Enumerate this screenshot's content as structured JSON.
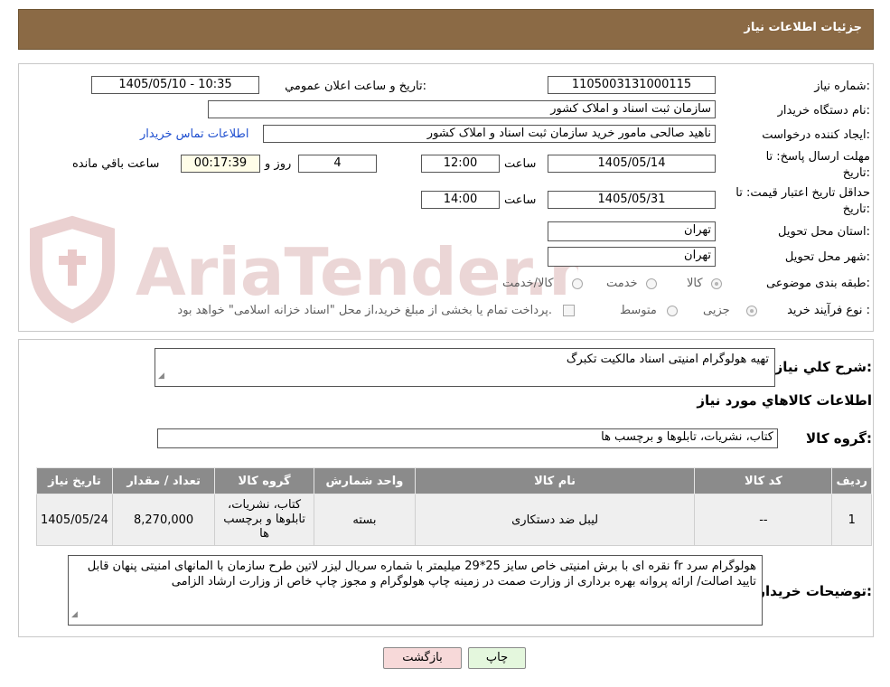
{
  "header": {
    "title": "جزئیات اطلاعات نیاز"
  },
  "watermark": {
    "text": "AriaTender.neT"
  },
  "form": {
    "need_number": {
      "label": "شماره نیاز:",
      "value": "1105003131000115"
    },
    "announce_datetime": {
      "label": "تاريخ و ساعت اعلان عمومي:",
      "value": "1405/05/10 - 10:35"
    },
    "buyer_org": {
      "label": "نام دستگاه خریدار:",
      "value": "سازمان ثبت اسناد و املاک کشور"
    },
    "requester": {
      "label": "ایجاد کننده درخواست:",
      "value": "ناهید صالحی مامور خرید سازمان ثبت اسناد و املاک کشور",
      "contact_link": "اطلاعات تماس خریدار"
    },
    "response_deadline": {
      "label_line1": "مهلت ارسال پاسخ: تا",
      "label_line2": "تاریخ:",
      "date": "1405/05/14",
      "time_label": "ساعت",
      "time": "12:00",
      "days": "4",
      "days_label": "روز و",
      "remaining": "00:17:39",
      "remaining_label": "ساعت باقي مانده"
    },
    "price_validity": {
      "label_line1": "حداقل تاریخ اعتبار قیمت: تا",
      "label_line2": "تاریخ:",
      "date": "1405/05/31",
      "time_label": "ساعت",
      "time": "14:00"
    },
    "delivery_province": {
      "label": "استان محل تحویل:",
      "value": "تهران"
    },
    "delivery_city": {
      "label": "شهر محل تحویل:",
      "value": "تهران"
    },
    "category": {
      "label": "طبقه بندی موضوعی:",
      "options": [
        "کالا",
        "خدمت",
        "کالا/خدمت"
      ],
      "selected": "کالا"
    },
    "purchase_type": {
      "label": "نوع فرآیند خرید :",
      "options": [
        "جزیی",
        "متوسط"
      ],
      "selected": "جزیی",
      "note": "پرداخت تمام یا بخشی از مبلغ خرید،از محل \"اسناد خزانه اسلامی\" خواهد بود."
    }
  },
  "description": {
    "label": "شرح کلي نياز:",
    "value": "تهیه هولوگرام امنیتی اسناد مالکیت تکبرگ"
  },
  "goods_section": {
    "title": "اطلاعات کالاهاي مورد نياز",
    "group_label": "گروه کالا:",
    "group_value": "کتاب، نشریات، تابلوها و برچسب ها"
  },
  "table": {
    "headers": [
      "رديف",
      "کد کالا",
      "نام کالا",
      "واحد شمارش",
      "گروه کالا",
      "تعداد / مقدار",
      "تاریخ نیاز"
    ],
    "rows": [
      [
        "1",
        "--",
        "لیبل ضد دستکاری",
        "بسته",
        "کتاب، نشریات، تابلوها و برچسب ها",
        "8,270,000",
        "1405/05/24"
      ]
    ]
  },
  "buyer_notes": {
    "label": "توضیحات خریدار:",
    "value": "هولوگرام سرد fr نقره ای با برش امنیتی خاص سایز 25*29 میلیمتر با شماره سریال لیزر لاتین طرح سازمان با المانهای امنیتی پنهان قابل تایید اصالت/ ارائه پروانه بهره برداری از وزارت صمت در زمینه چاپ هولوگرام و مجوز چاپ خاص از وزارت ارشاد الزامی"
  },
  "buttons": {
    "print": "چاپ",
    "back": "بازگشت"
  },
  "colors": {
    "header_bg": "#8b6a45",
    "table_header_bg": "#8b8b8b",
    "back_button_bg": "#f7d9d9",
    "print_button_bg": "#e4f7dd",
    "link": "#1f4fd0"
  }
}
